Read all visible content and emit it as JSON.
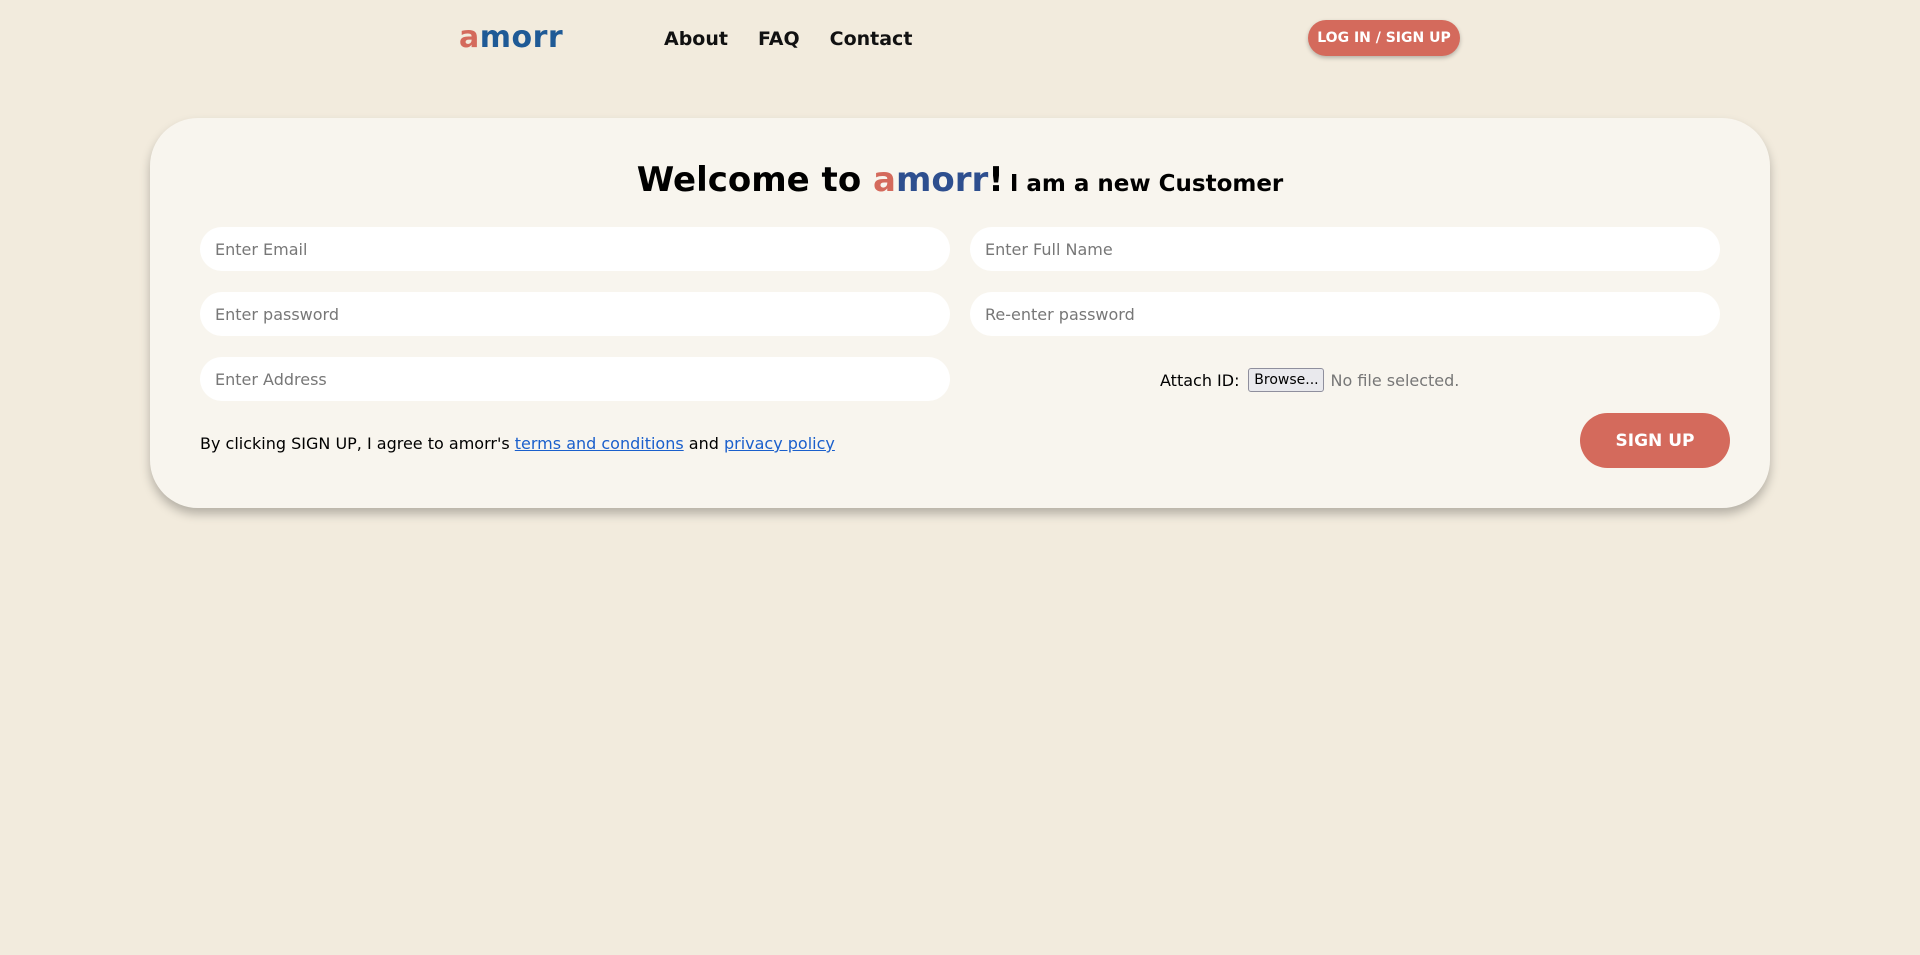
{
  "navbar": {
    "logo": {
      "first_letter": "a",
      "rest": "morr"
    },
    "links": [
      "About",
      "FAQ",
      "Contact"
    ],
    "login_label": "LOG IN / SIGN UP"
  },
  "card": {
    "heading": {
      "welcome": "Welcome to ",
      "brand_first": "a",
      "brand_rest": "morr",
      "bang": "!",
      "subtitle": "I am a new Customer"
    },
    "fields": {
      "email_placeholder": "Enter Email",
      "fullname_placeholder": "Enter Full Name",
      "password_placeholder": "Enter password",
      "repassword_placeholder": "Re-enter password",
      "address_placeholder": "Enter Address"
    },
    "attach": {
      "label": "Attach ID:",
      "browse_label": "Browse...",
      "status": "No file selected."
    },
    "agreement": {
      "prefix": "By clicking SIGN UP, I agree to amorr's ",
      "terms": "terms and conditions",
      "middle": " and ",
      "privacy": "privacy policy"
    },
    "signup_label": "SIGN UP"
  },
  "colors": {
    "background": "#f2ebdd",
    "card": "#f8f5ee",
    "accent": "#d46a5c",
    "brand_blue": "#1f5a96",
    "link": "#1a5fcc"
  }
}
